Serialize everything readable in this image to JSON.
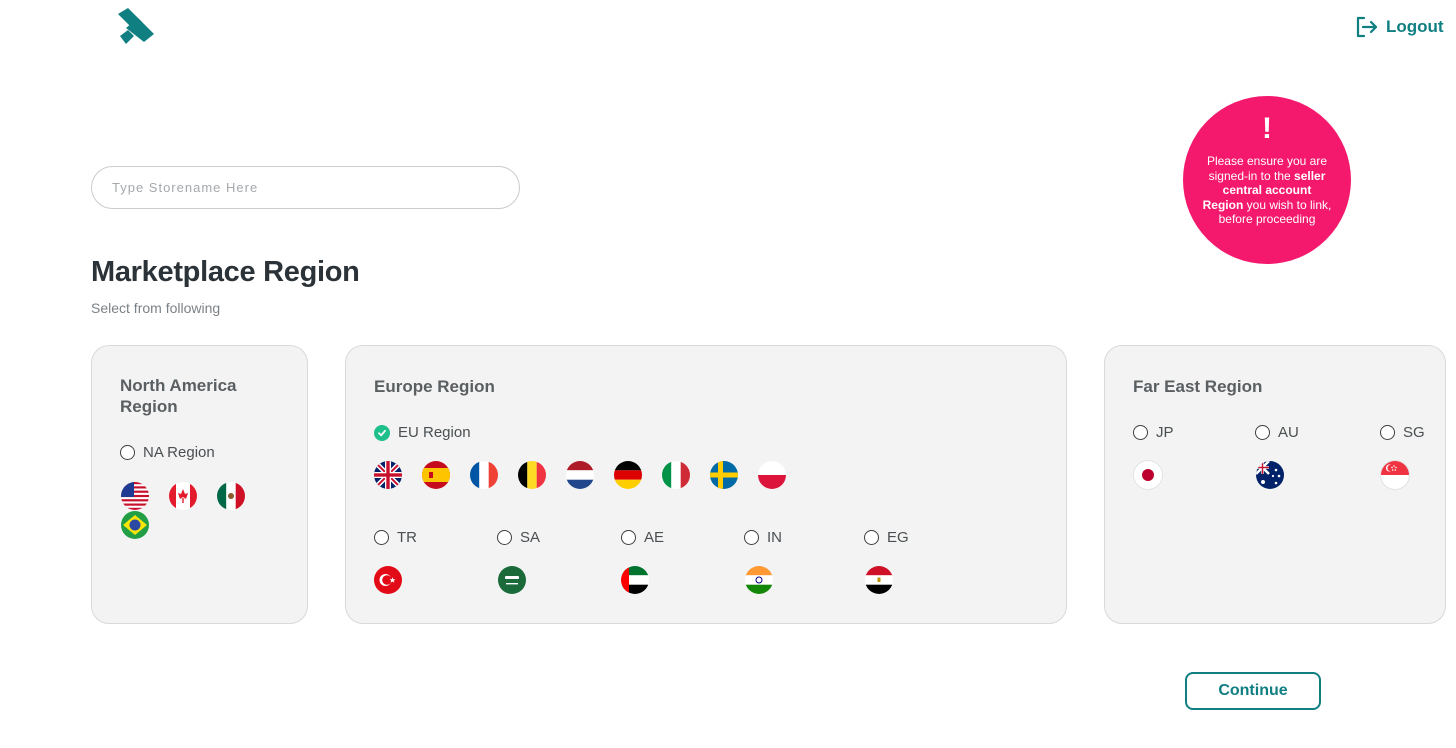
{
  "header": {
    "logout_label": "Logout"
  },
  "store_search": {
    "placeholder": "Type Storename Here",
    "value": ""
  },
  "notice": {
    "icon": "!",
    "line1": "Please ensure you are signed-in to the ",
    "bold1": "seller central account Region",
    "line2": " you wish to link, before proceeding"
  },
  "marketplace": {
    "title": "Marketplace Region",
    "subtitle": "Select from following"
  },
  "regions": {
    "north_america": {
      "title": "North America Region",
      "option": "NA Region",
      "selected": false,
      "flags": [
        "us",
        "ca",
        "mx",
        "br"
      ]
    },
    "europe": {
      "title": "Europe Region",
      "option": "EU Region",
      "selected": true,
      "flags": [
        "gb",
        "es",
        "fr",
        "be",
        "nl",
        "de",
        "it",
        "se",
        "pl"
      ],
      "extra": [
        {
          "label": "TR",
          "flag": "tr"
        },
        {
          "label": "SA",
          "flag": "sa"
        },
        {
          "label": "AE",
          "flag": "ae"
        },
        {
          "label": "IN",
          "flag": "in"
        },
        {
          "label": "EG",
          "flag": "eg"
        }
      ]
    },
    "far_east": {
      "title": "Far East Region",
      "options": [
        {
          "label": "JP",
          "flag": "jp"
        },
        {
          "label": "AU",
          "flag": "au"
        },
        {
          "label": "SG",
          "flag": "sg"
        }
      ]
    }
  },
  "actions": {
    "continue_label": "Continue"
  },
  "colors": {
    "brand": "#0f7f82",
    "notice": "#f4196d",
    "selected": "#1dbf8a"
  }
}
